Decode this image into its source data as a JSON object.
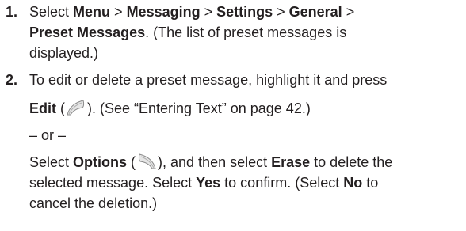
{
  "step1": {
    "number": "1.",
    "select_word": "Select",
    "menu": "Menu",
    "sep1": " > ",
    "messaging": "Messaging",
    "sep2": " > ",
    "settings": "Settings",
    "sep3": " > ",
    "general": "General",
    "sep4": " >",
    "preset_messages": "Preset Messages",
    "period": ".",
    "note": " (The list of preset messages is",
    "note_cont": "displayed.)"
  },
  "step2": {
    "number": "2.",
    "instruction": "To edit or delete a preset message, highlight it and press",
    "edit_label": "Edit",
    "paren_open": " (",
    "paren_close": ").",
    "see_ref": " (See “Entering Text” on page 42.)",
    "or_separator": "– or –",
    "select_word": "Select ",
    "options_label": "Options",
    "options_paren_open": " (",
    "options_after": "), and then select ",
    "erase_label": "Erase",
    "erase_after": " to delete the",
    "line_selected": "selected message. Select ",
    "yes_label": "Yes",
    "confirm_text": " to confirm. (Select ",
    "no_label": "No",
    "to_text": " to",
    "cancel_text": "cancel the deletion.)"
  },
  "icons": {
    "left_softkey": "left-softkey-icon",
    "right_softkey": "right-softkey-icon"
  }
}
